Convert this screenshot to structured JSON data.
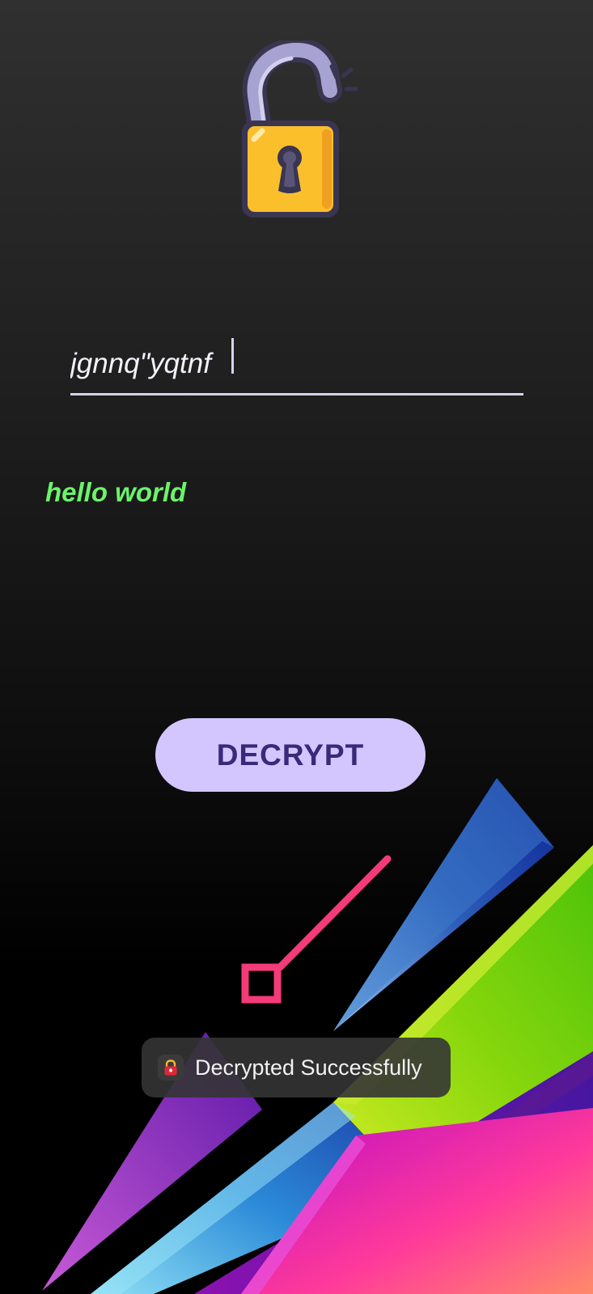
{
  "app": {
    "icon": "unlocked-padlock-icon",
    "accent_color": "#d3c5fe",
    "result_color": "#6cf36c"
  },
  "input": {
    "value": "jgnnq\"yqtnf",
    "placeholder": ""
  },
  "result": {
    "text": "hello world"
  },
  "actions": {
    "decrypt_label": "DECRYPT"
  },
  "toast": {
    "icon": "padlock-app-icon",
    "message": "Decrypted Successfully"
  }
}
